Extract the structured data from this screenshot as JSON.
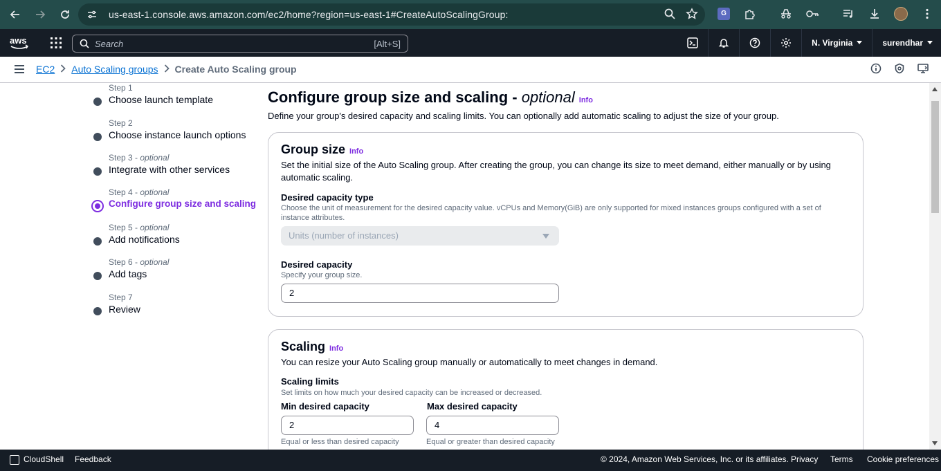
{
  "browser": {
    "url": "us-east-1.console.aws.amazon.com/ec2/home?region=us-east-1#CreateAutoScalingGroup:"
  },
  "aws_nav": {
    "search_placeholder": "Search",
    "search_shortcut": "[Alt+S]",
    "region": "N. Virginia",
    "user": "surendhar"
  },
  "breadcrumb": {
    "items": [
      "EC2",
      "Auto Scaling groups"
    ],
    "current": "Create Auto Scaling group"
  },
  "steps": [
    {
      "label": "Step 1",
      "optional": "",
      "name": "Choose launch template"
    },
    {
      "label": "Step 2",
      "optional": "",
      "name": "Choose instance launch options"
    },
    {
      "label": "Step 3 - ",
      "optional": "optional",
      "name": "Integrate with other services"
    },
    {
      "label": "Step 4 - ",
      "optional": "optional",
      "name": "Configure group size and scaling"
    },
    {
      "label": "Step 5 - ",
      "optional": "optional",
      "name": "Add notifications"
    },
    {
      "label": "Step 6 - ",
      "optional": "optional",
      "name": "Add tags"
    },
    {
      "label": "Step 7",
      "optional": "",
      "name": "Review"
    }
  ],
  "page": {
    "title": "Configure group size and scaling - ",
    "title_optional": "optional",
    "info": "Info",
    "description": "Define your group's desired capacity and scaling limits. You can optionally add automatic scaling to adjust the size of your group."
  },
  "group_size": {
    "title": "Group size",
    "info": "Info",
    "description": "Set the initial size of the Auto Scaling group. After creating the group, you can change its size to meet demand, either manually or by using automatic scaling.",
    "capacity_type_label": "Desired capacity type",
    "capacity_type_help": "Choose the unit of measurement for the desired capacity value. vCPUs and Memory(GiB) are only supported for mixed instances groups configured with a set of instance attributes.",
    "capacity_type_value": "Units (number of instances)",
    "desired_capacity_label": "Desired capacity",
    "desired_capacity_help": "Specify your group size.",
    "desired_capacity_value": "2"
  },
  "scaling": {
    "title": "Scaling",
    "info": "Info",
    "description": "You can resize your Auto Scaling group manually or automatically to meet changes in demand.",
    "limits_label": "Scaling limits",
    "limits_help": "Set limits on how much your desired capacity can be increased or decreased.",
    "min_label": "Min desired capacity",
    "min_value": "2",
    "min_constraint": "Equal or less than desired capacity",
    "max_label": "Max desired capacity",
    "max_value": "4",
    "max_constraint": "Equal or greater than desired capacity"
  },
  "footer": {
    "cloudshell": "CloudShell",
    "feedback": "Feedback",
    "copyright": "© 2024, Amazon Web Services, Inc. or its affiliates.",
    "privacy": "Privacy",
    "terms": "Terms",
    "cookie": "Cookie preferences"
  },
  "colors": {
    "accent_purple": "#7d2ce0",
    "link_blue": "#0972d3",
    "nav_dark": "#161d26"
  }
}
